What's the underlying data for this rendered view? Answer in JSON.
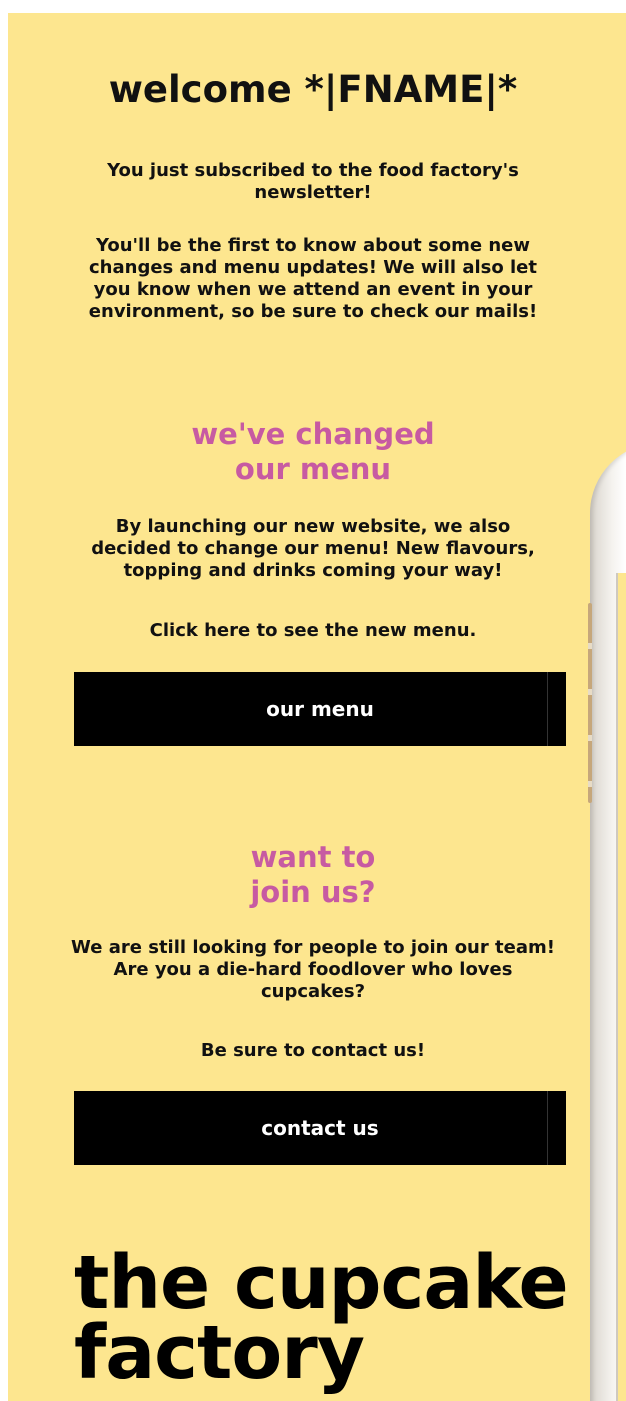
{
  "email": {
    "welcome_title": "welcome *|FNAME|*",
    "intro_line1": "You just subscribed to the food factory's newsletter!",
    "intro_line2": "You'll be the first to know about some new changes and menu updates! We will also let you know when we attend an event in your environment, so be sure to check our mails!"
  },
  "menu_section": {
    "heading_line1": "we've changed",
    "heading_line2": "our menu",
    "text": "By launching our new website, we also decided to change our menu! New flavours, topping and drinks coming your way!",
    "cta_text": "Click here to see the new menu.",
    "button_label": "our menu"
  },
  "join_section": {
    "heading_line1": "want to",
    "heading_line2": "join us?",
    "text": "We are still looking for people to join our team! Are you a die-hard foodlover who loves cupcakes?",
    "cta_text": "Be sure to contact us!",
    "button_label": "contact us"
  },
  "brand": {
    "line1": "the cupcake",
    "line2": "factory"
  },
  "colors": {
    "background": "#fde68f",
    "accent_pink": "#c75aa2",
    "button": "#000000",
    "button_text": "#ffffff"
  }
}
